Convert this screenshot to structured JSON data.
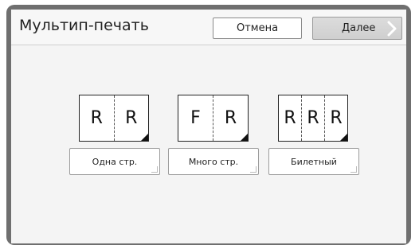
{
  "header": {
    "title": "Мультип-печать",
    "cancel_label": "Отмена",
    "next_label": "Далее"
  },
  "options": [
    {
      "name": "single",
      "label": "Одна стр.",
      "cells": [
        "R",
        "R"
      ]
    },
    {
      "name": "multi",
      "label": "Много стр.",
      "cells": [
        "F",
        "R"
      ]
    },
    {
      "name": "ticket",
      "label": "Билетный",
      "cells": [
        "R",
        "R",
        "R"
      ]
    }
  ]
}
